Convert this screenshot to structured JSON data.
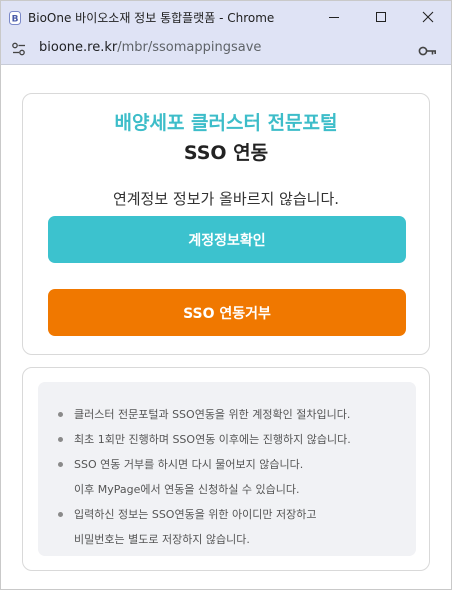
{
  "window": {
    "title": "BioOne 바이오소재 정보 통합플랫폼 - Chrome"
  },
  "address_bar": {
    "host": "bioone.re.kr",
    "path": "/mbr/ssomappingsave"
  },
  "main": {
    "portal_title": "배양세포 클러스터 전문포털",
    "sso_title": "SSO 연동",
    "message": "연계정보 정보가 올바르지 않습니다.",
    "verify_button": "계정정보확인",
    "reject_button": "SSO 연동거부"
  },
  "notice": {
    "items": [
      {
        "lines": [
          "클러스터 전문포털과 SSO연동을 위한 계정확인 절차입니다."
        ]
      },
      {
        "lines": [
          "최초 1회만 진행하며 SSO연동 이후에는 진행하지 않습니다."
        ]
      },
      {
        "lines": [
          "SSO 연동 거부를 하시면 다시 물어보지 않습니다.",
          "이후 MyPage에서 연동을 신청하실 수 있습니다."
        ]
      },
      {
        "lines": [
          "입력하신 정보는 SSO연동을 위한 아이디만 저장하고",
          "비밀번호는 별도로 저장하지 않습니다."
        ]
      }
    ]
  },
  "colors": {
    "accent_teal": "#3dbdc9",
    "verify_button": "#3cc2ce",
    "reject_button": "#f07800",
    "titlebar": "#dfe3f5"
  },
  "icons": {
    "app": "bioone-app-icon",
    "minimize": "minimize-icon",
    "maximize": "maximize-icon",
    "close": "close-icon",
    "site_info": "tune-icon",
    "password": "key-icon"
  }
}
